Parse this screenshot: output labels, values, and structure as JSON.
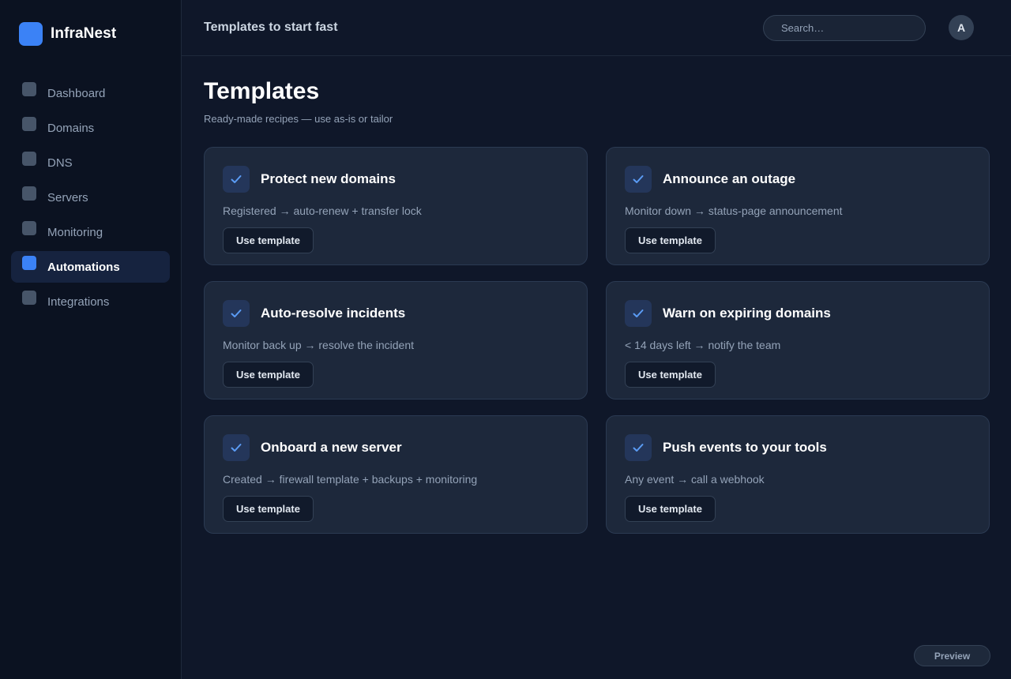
{
  "brand": {
    "name": "InfraNest",
    "accent": "#3b82f6"
  },
  "sidebar": {
    "items": [
      {
        "label": "Dashboard",
        "active": false
      },
      {
        "label": "Domains",
        "active": false
      },
      {
        "label": "DNS",
        "active": false
      },
      {
        "label": "Servers",
        "active": false
      },
      {
        "label": "Monitoring",
        "active": false
      },
      {
        "label": "Automations",
        "active": true
      },
      {
        "label": "Integrations",
        "active": false
      }
    ]
  },
  "topbar": {
    "title": "Templates to start fast",
    "search_placeholder": "Search…",
    "avatar_initial": "A"
  },
  "page": {
    "title": "Templates",
    "subtitle": "Ready-made recipes — use as-is or tailor"
  },
  "templates": [
    {
      "title": "Protect new domains",
      "description": "Registered → auto-renew + transfer lock",
      "button": "Use template",
      "icon": "check-icon"
    },
    {
      "title": "Announce an outage",
      "description": "Monitor down → status-page announcement",
      "button": "Use template",
      "icon": "check-icon"
    },
    {
      "title": "Auto-resolve incidents",
      "description": "Monitor back up → resolve the incident",
      "button": "Use template",
      "icon": "check-icon"
    },
    {
      "title": "Warn on expiring domains",
      "description": "< 14 days left → notify the team",
      "button": "Use template",
      "icon": "check-icon"
    },
    {
      "title": "Onboard a new server",
      "description": "Created → firewall template + backups + monitoring",
      "button": "Use template",
      "icon": "check-icon"
    },
    {
      "title": "Push events to your tools",
      "description": "Any event → call a webhook",
      "button": "Use template",
      "icon": "check-icon"
    }
  ],
  "footer": {
    "preview_label": "Preview"
  }
}
